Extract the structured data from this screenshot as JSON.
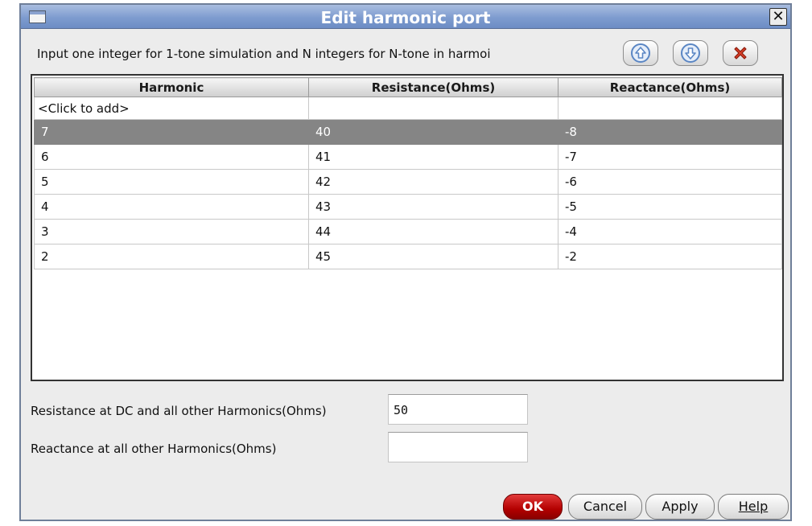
{
  "window": {
    "title": "Edit harmonic port"
  },
  "instruction": "Input one integer for 1-tone simulation and N integers for N-tone in harmoi",
  "table": {
    "columns": [
      "Harmonic",
      "Resistance(Ohms)",
      "Reactance(Ohms)"
    ],
    "add_row_label": "<Click to add>",
    "selected_row": 0,
    "rows": [
      [
        "7",
        "40",
        "-8"
      ],
      [
        "6",
        "41",
        "-7"
      ],
      [
        "5",
        "42",
        "-6"
      ],
      [
        "4",
        "43",
        "-5"
      ],
      [
        "3",
        "44",
        "-4"
      ],
      [
        "2",
        "45",
        "-2"
      ]
    ]
  },
  "fields": {
    "resistance_label": "Resistance at DC and all other Harmonics(Ohms)",
    "resistance_value": "50",
    "reactance_label": "Reactance at all other Harmonics(Ohms)",
    "reactance_value": ""
  },
  "buttons": {
    "ok": "OK",
    "cancel": "Cancel",
    "apply": "Apply",
    "help": "Help"
  },
  "icons": {
    "move_up": "arrow-up-icon",
    "move_down": "arrow-down-icon",
    "delete": "delete-x-icon",
    "close": "close-icon"
  },
  "colors": {
    "title_bar": "#7e9ccf",
    "selected_row": "#858585",
    "ok_button": "#b30000",
    "delete_icon": "#c8321e",
    "arrow_icon": "#5a86c4"
  }
}
